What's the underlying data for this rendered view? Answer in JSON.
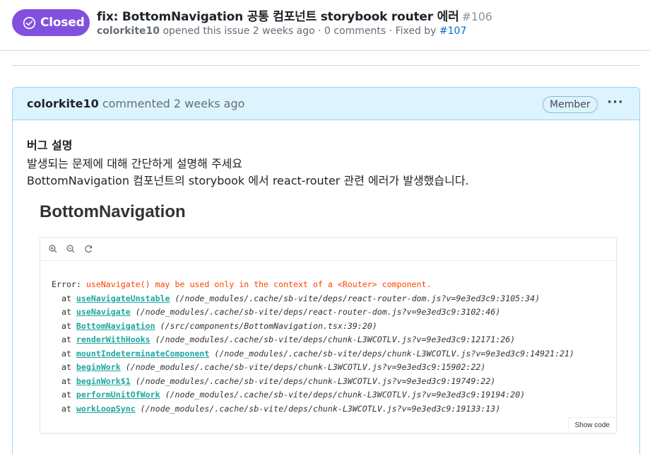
{
  "issue": {
    "state_label": "Closed",
    "title": "fix: BottomNavigation 공통 컴포넌트 storybook router 에러",
    "number": "#106",
    "author": "colorkite10",
    "meta_text": " opened this issue 2 weeks ago · 0 comments · Fixed by ",
    "fixed_by": "#107",
    "colors": {
      "closed": "#8250df",
      "link": "#0969da",
      "comment_header_bg": "#ddf4ff"
    }
  },
  "comment": {
    "author": "colorkite10",
    "action": " commented 2 weeks ago",
    "role_badge": "Member",
    "more_label": "···",
    "heading": "버그 설명",
    "lines": [
      "발생되는 문제에 대해 간단하게 설명해 주세요",
      "BottomNavigation 컴포넌트의 storybook 에서 react-router 관련 에러가 발생했습니다."
    ]
  },
  "storybook": {
    "title": "BottomNavigation",
    "toolbar_icons": [
      "zoom-in-icon",
      "zoom-out-icon",
      "reset-zoom-icon"
    ],
    "error_prefix": "Error: ",
    "error_message": "useNavigate() may be used only in the context of a <Router> component.",
    "stack": [
      {
        "fn": "useNavigateUnstable",
        "path": "(/node_modules/.cache/sb-vite/deps/react-router-dom.js?v=9e3ed3c9:3105:34)"
      },
      {
        "fn": "useNavigate",
        "path": "(/node_modules/.cache/sb-vite/deps/react-router-dom.js?v=9e3ed3c9:3102:46)"
      },
      {
        "fn": "BottomNavigation",
        "path": "(/src/components/BottomNavigation.tsx:39:20)"
      },
      {
        "fn": "renderWithHooks",
        "path": "(/node_modules/.cache/sb-vite/deps/chunk-L3WCOTLV.js?v=9e3ed3c9:12171:26)"
      },
      {
        "fn": "mountIndeterminateComponent",
        "path": "(/node_modules/.cache/sb-vite/deps/chunk-L3WCOTLV.js?v=9e3ed3c9:14921:21)"
      },
      {
        "fn": "beginWork",
        "path": "(/node_modules/.cache/sb-vite/deps/chunk-L3WCOTLV.js?v=9e3ed3c9:15902:22)"
      },
      {
        "fn": "beginWork$1",
        "path": "(/node_modules/.cache/sb-vite/deps/chunk-L3WCOTLV.js?v=9e3ed3c9:19749:22)"
      },
      {
        "fn": "performUnitOfWork",
        "path": "(/node_modules/.cache/sb-vite/deps/chunk-L3WCOTLV.js?v=9e3ed3c9:19194:20)"
      },
      {
        "fn": "workLoopSync",
        "path": "(/node_modules/.cache/sb-vite/deps/chunk-L3WCOTLV.js?v=9e3ed3c9:19133:13)"
      }
    ],
    "stack_at": "at",
    "show_code_label": "Show code",
    "colors": {
      "error": "#ff4400",
      "fn_link": "#1ea7a0"
    }
  }
}
